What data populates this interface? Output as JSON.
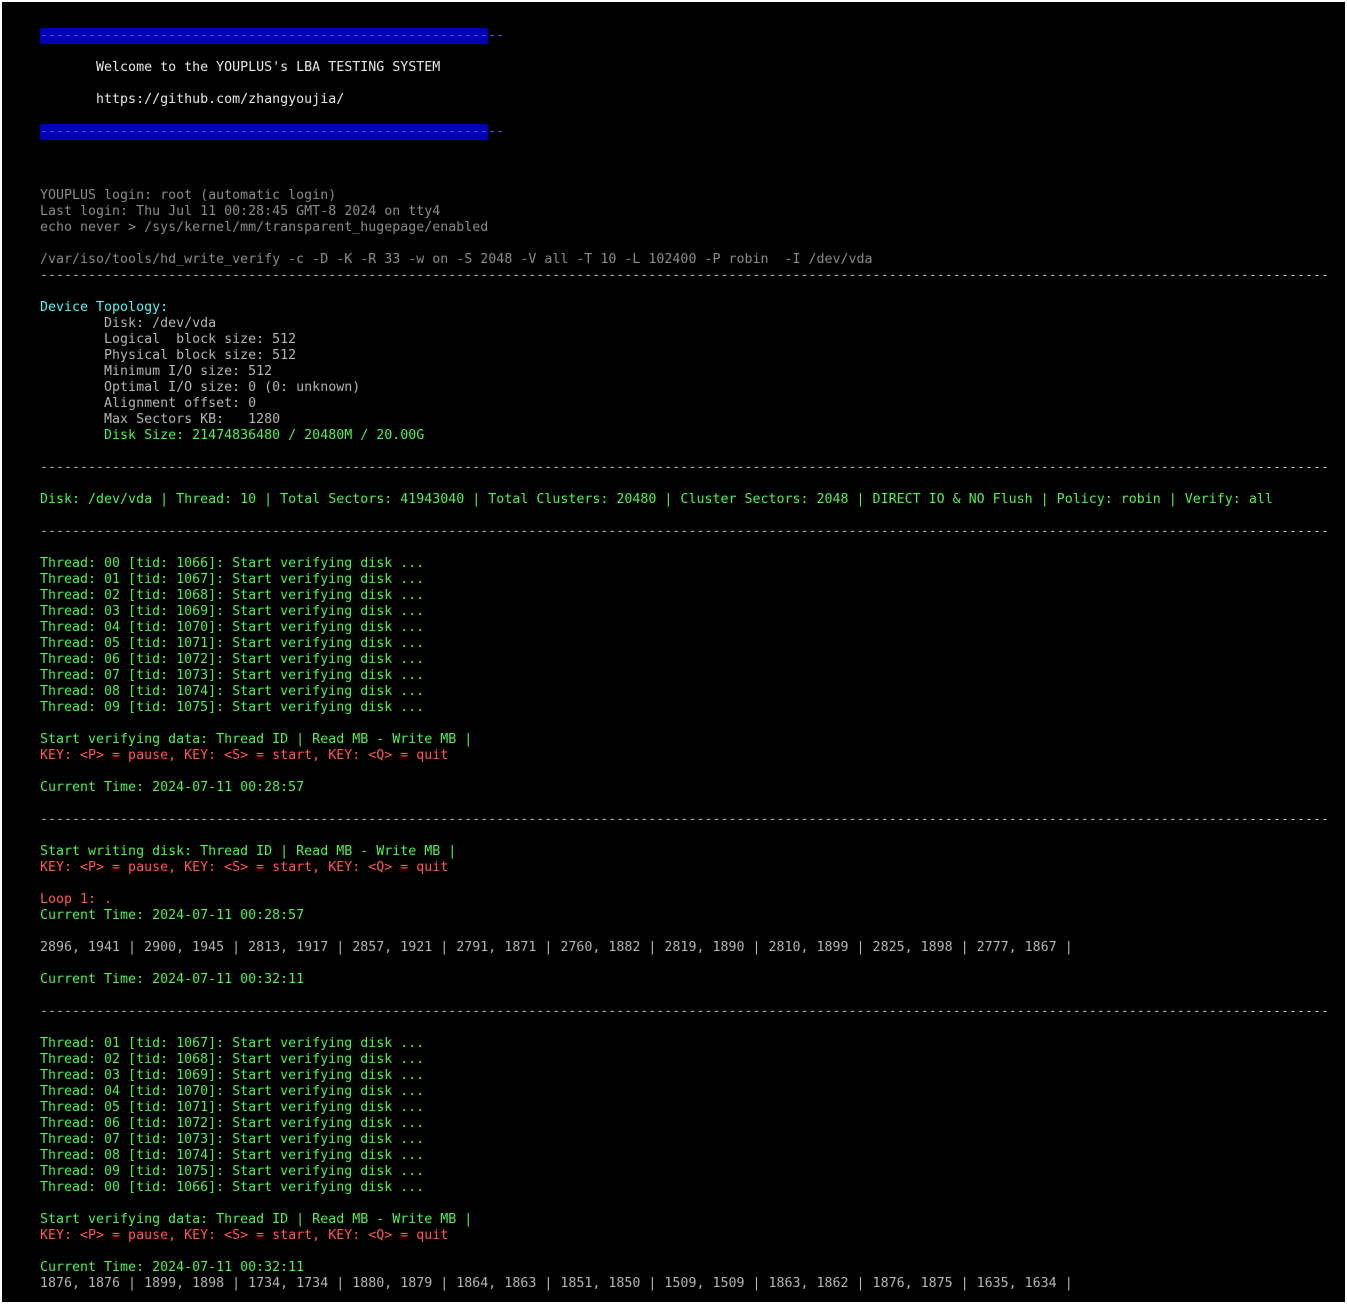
{
  "theme": {
    "background": "#000000",
    "banner_bg": "#0000b4",
    "text_gray": "#b4b4b4",
    "text_dim": "#8a8a8a",
    "text_green": "#55ee55",
    "text_red": "#ff5555",
    "text_cyan": "#5ff0f0"
  },
  "lines": [
    {
      "text": "----------------------------------------------------------",
      "style": "blue",
      "banner": true
    },
    {
      "text": "",
      "style": "gray"
    },
    {
      "text": "       Welcome to the YOUPLUS's LBA TESTING SYSTEM",
      "style": "white"
    },
    {
      "text": "",
      "style": "gray"
    },
    {
      "text": "       https://github.com/zhangyoujia/",
      "style": "white"
    },
    {
      "text": "",
      "style": "gray"
    },
    {
      "text": "----------------------------------------------------------",
      "style": "blue",
      "banner": true
    },
    {
      "text": "",
      "style": "gray"
    },
    {
      "text": "",
      "style": "gray"
    },
    {
      "text": "",
      "style": "gray"
    },
    {
      "text": "YOUPLUS login: root (automatic login)",
      "style": "dgray"
    },
    {
      "text": "Last login: Thu Jul 11 00:28:45 GMT-8 2024 on tty4",
      "style": "dgray"
    },
    {
      "text": "echo never > /sys/kernel/mm/transparent_hugepage/enabled",
      "style": "dgray"
    },
    {
      "text": "",
      "style": "gray"
    },
    {
      "text": "/var/iso/tools/hd_write_verify -c -D -K -R 33 -w on -S 2048 -V all -T 10 -L 102400 -P robin  -I /dev/vda",
      "style": "dgray"
    },
    {
      "text": "--------------------------------------------------------------------------------------------------------------------------------------------------------------------",
      "style": "gray"
    },
    {
      "text": "",
      "style": "gray"
    },
    {
      "text": "Device Topology:",
      "style": "cyan"
    },
    {
      "text": "        Disk: /dev/vda",
      "style": "gray"
    },
    {
      "text": "        Logical  block size: 512",
      "style": "gray"
    },
    {
      "text": "        Physical block size: 512",
      "style": "gray"
    },
    {
      "text": "        Minimum I/O size: 512",
      "style": "gray"
    },
    {
      "text": "        Optimal I/O size: 0 (0: unknown)",
      "style": "gray"
    },
    {
      "text": "        Alignment offset: 0",
      "style": "gray"
    },
    {
      "text": "        Max Sectors KB:   1280",
      "style": "gray"
    },
    {
      "text": "        Disk Size: 21474836480 / 20480M / 20.00G",
      "style": "green"
    },
    {
      "text": "",
      "style": "gray"
    },
    {
      "text": "--------------------------------------------------------------------------------------------------------------------------------------------------------------------",
      "style": "gray"
    },
    {
      "text": "",
      "style": "gray"
    },
    {
      "text": "Disk: /dev/vda | Thread: 10 | Total Sectors: 41943040 | Total Clusters: 20480 | Cluster Sectors: 2048 | DIRECT IO & NO Flush | Policy: robin | Verify: all",
      "style": "green"
    },
    {
      "text": "",
      "style": "gray"
    },
    {
      "text": "--------------------------------------------------------------------------------------------------------------------------------------------------------------------",
      "style": "gray"
    },
    {
      "text": "",
      "style": "gray"
    },
    {
      "text": "Thread: 00 [tid: 1066]: Start verifying disk ...",
      "style": "green"
    },
    {
      "text": "Thread: 01 [tid: 1067]: Start verifying disk ...",
      "style": "green"
    },
    {
      "text": "Thread: 02 [tid: 1068]: Start verifying disk ...",
      "style": "green"
    },
    {
      "text": "Thread: 03 [tid: 1069]: Start verifying disk ...",
      "style": "green"
    },
    {
      "text": "Thread: 04 [tid: 1070]: Start verifying disk ...",
      "style": "green"
    },
    {
      "text": "Thread: 05 [tid: 1071]: Start verifying disk ...",
      "style": "green"
    },
    {
      "text": "Thread: 06 [tid: 1072]: Start verifying disk ...",
      "style": "green"
    },
    {
      "text": "Thread: 07 [tid: 1073]: Start verifying disk ...",
      "style": "green"
    },
    {
      "text": "Thread: 08 [tid: 1074]: Start verifying disk ...",
      "style": "green"
    },
    {
      "text": "Thread: 09 [tid: 1075]: Start verifying disk ...",
      "style": "green"
    },
    {
      "text": "",
      "style": "gray"
    },
    {
      "text": "Start verifying data: Thread ID | Read MB - Write MB |",
      "style": "green"
    },
    {
      "text": "KEY: <P> = pause, KEY: <S> = start, KEY: <Q> = quit",
      "style": "red"
    },
    {
      "text": "",
      "style": "gray"
    },
    {
      "text": "Current Time: 2024-07-11 00:28:57",
      "style": "green"
    },
    {
      "text": "",
      "style": "gray"
    },
    {
      "text": "--------------------------------------------------------------------------------------------------------------------------------------------------------------------",
      "style": "gray"
    },
    {
      "text": "",
      "style": "gray"
    },
    {
      "text": "Start writing disk: Thread ID | Read MB - Write MB |",
      "style": "green"
    },
    {
      "text": "KEY: <P> = pause, KEY: <S> = start, KEY: <Q> = quit",
      "style": "red"
    },
    {
      "text": "",
      "style": "gray"
    },
    {
      "text": "Loop 1: .",
      "style": "red"
    },
    {
      "text": "Current Time: 2024-07-11 00:28:57",
      "style": "green"
    },
    {
      "text": "",
      "style": "gray"
    },
    {
      "text": "2896, 1941 | 2900, 1945 | 2813, 1917 | 2857, 1921 | 2791, 1871 | 2760, 1882 | 2819, 1890 | 2810, 1899 | 2825, 1898 | 2777, 1867 |",
      "style": "gray"
    },
    {
      "text": "",
      "style": "gray"
    },
    {
      "text": "Current Time: 2024-07-11 00:32:11",
      "style": "green"
    },
    {
      "text": "",
      "style": "gray"
    },
    {
      "text": "--------------------------------------------------------------------------------------------------------------------------------------------------------------------",
      "style": "gray"
    },
    {
      "text": "",
      "style": "gray"
    },
    {
      "text": "Thread: 01 [tid: 1067]: Start verifying disk ...",
      "style": "green"
    },
    {
      "text": "Thread: 02 [tid: 1068]: Start verifying disk ...",
      "style": "green"
    },
    {
      "text": "Thread: 03 [tid: 1069]: Start verifying disk ...",
      "style": "green"
    },
    {
      "text": "Thread: 04 [tid: 1070]: Start verifying disk ...",
      "style": "green"
    },
    {
      "text": "Thread: 05 [tid: 1071]: Start verifying disk ...",
      "style": "green"
    },
    {
      "text": "Thread: 06 [tid: 1072]: Start verifying disk ...",
      "style": "green"
    },
    {
      "text": "Thread: 07 [tid: 1073]: Start verifying disk ...",
      "style": "green"
    },
    {
      "text": "Thread: 08 [tid: 1074]: Start verifying disk ...",
      "style": "green"
    },
    {
      "text": "Thread: 09 [tid: 1075]: Start verifying disk ...",
      "style": "green"
    },
    {
      "text": "Thread: 00 [tid: 1066]: Start verifying disk ...",
      "style": "green"
    },
    {
      "text": "",
      "style": "gray"
    },
    {
      "text": "Start verifying data: Thread ID | Read MB - Write MB |",
      "style": "green"
    },
    {
      "text": "KEY: <P> = pause, KEY: <S> = start, KEY: <Q> = quit",
      "style": "red"
    },
    {
      "text": "",
      "style": "gray"
    },
    {
      "text": "Current Time: 2024-07-11 00:32:11",
      "style": "green"
    },
    {
      "text": "1876, 1876 | 1899, 1898 | 1734, 1734 | 1880, 1879 | 1864, 1863 | 1851, 1850 | 1509, 1509 | 1863, 1862 | 1876, 1875 | 1635, 1634 |",
      "style": "gray"
    }
  ]
}
